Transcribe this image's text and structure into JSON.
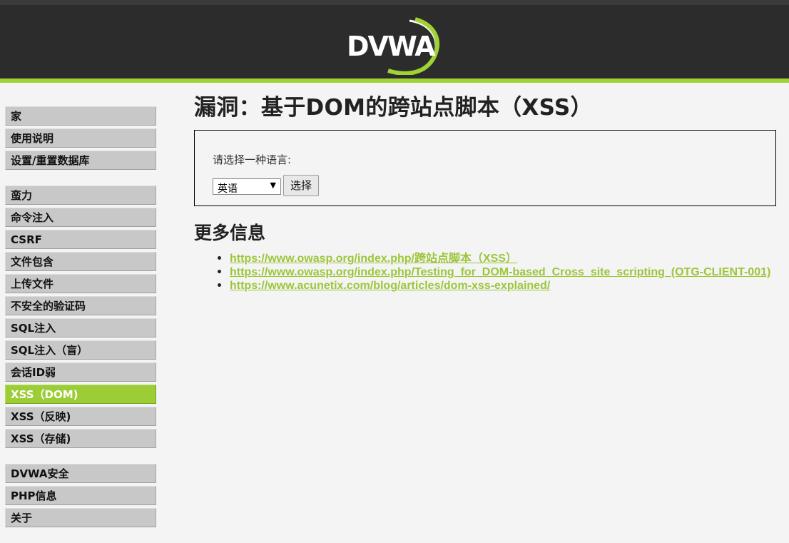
{
  "header": {
    "logo_text": "DVWA"
  },
  "sidebar": {
    "groups": [
      {
        "items": [
          {
            "label": "家"
          },
          {
            "label": "使用说明"
          },
          {
            "label": "设置/重置数据库"
          }
        ]
      },
      {
        "items": [
          {
            "label": "蛮力"
          },
          {
            "label": "命令注入"
          },
          {
            "label": "CSRF"
          },
          {
            "label": "文件包含"
          },
          {
            "label": "上传文件"
          },
          {
            "label": "不安全的验证码"
          },
          {
            "label": "SQL注入"
          },
          {
            "label": "SQL注入（盲）"
          },
          {
            "label": "会话ID弱"
          },
          {
            "label": "XSS（DOM)",
            "selected": true
          },
          {
            "label": "XSS（反映)"
          },
          {
            "label": "XSS（存储)"
          }
        ]
      },
      {
        "items": [
          {
            "label": "DVWA安全"
          },
          {
            "label": "PHP信息"
          },
          {
            "label": "关于"
          }
        ]
      }
    ]
  },
  "main": {
    "title": "漏洞：基于DOM的跨站点脚本（XSS）",
    "form": {
      "prompt": "请选择一种语言:",
      "language_selected": "英语",
      "submit_label": "选择"
    },
    "more_info": {
      "heading": "更多信息",
      "links": [
        "https://www.owasp.org/index.php/跨站点脚本（XSS）",
        "https://www.owasp.org/index.php/Testing_for_DOM-based_Cross_site_scripting_(OTG-CLIENT-001)",
        "https://www.acunetix.com/blog/articles/dom-xss-explained/"
      ]
    }
  },
  "colors": {
    "accent": "#9ccc36",
    "header_bg": "#2c2c2c",
    "link": "#9cc63a"
  }
}
